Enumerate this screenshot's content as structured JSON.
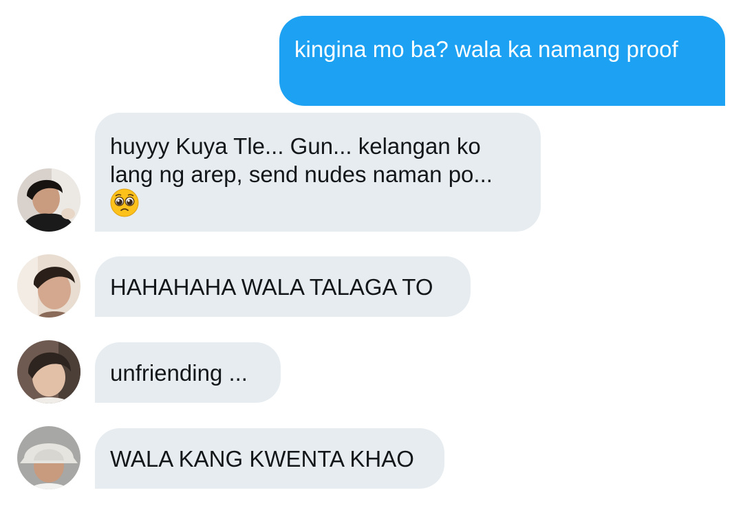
{
  "messages": [
    {
      "direction": "outgoing",
      "text": "kingina mo ba? wala ka namang proof"
    },
    {
      "direction": "incoming",
      "text": "huyyy Kuya Tle... Gun... kelangan ko lang ng arep, send nudes naman po...",
      "emoji": "pleading-face-icon"
    },
    {
      "direction": "incoming",
      "text": "HAHAHAHA WALA TALAGA TO"
    },
    {
      "direction": "incoming",
      "text": "unfriending ..."
    },
    {
      "direction": "incoming",
      "text": "WALA KANG KWENTA KHAO"
    }
  ],
  "colors": {
    "outgoing_bubble": "#1da1f2",
    "incoming_bubble": "#e6ecf0",
    "incoming_text": "#14171a",
    "outgoing_text": "#ffffff"
  }
}
